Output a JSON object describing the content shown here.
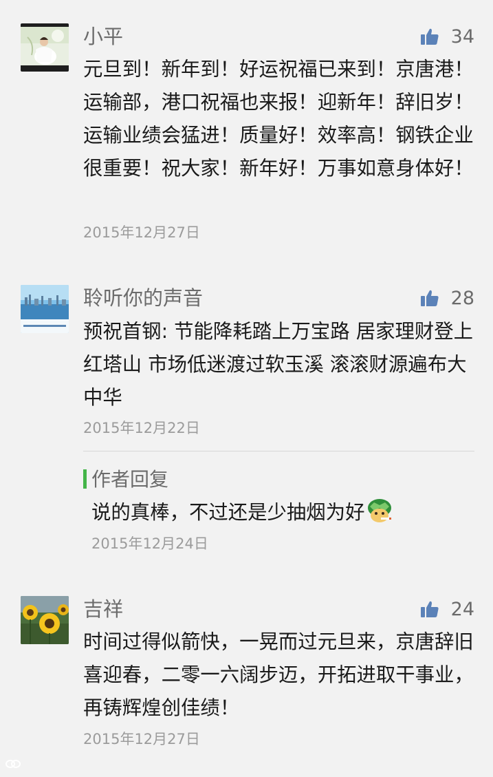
{
  "comments": [
    {
      "username": "小平",
      "likes": "34",
      "content": "元旦到！新年到！好运祝福已来到！京唐港！运输部，港口祝福也来报！迎新年！辞旧岁！运输业绩会猛进！质量好！效率高！钢铁企业很重要！祝大家！新年好！万事如意身体好！",
      "date": "2015年12月27日",
      "avatar": "bride-photo-avatar"
    },
    {
      "username": "聆听你的声音",
      "likes": "28",
      "content": "预祝首钢: 节能降耗踏上万宝路 居家理财登上红塔山 市场低迷渡过软玉溪 滚滚财源遍布大中华",
      "date": "2015年12月22日",
      "avatar": "harbor-skyline-avatar",
      "reply": {
        "title": "作者回复",
        "content": "说的真棒，不过还是少抽烟为好",
        "emoji": "smoking-turtle-emoji",
        "date": "2015年12月24日"
      }
    },
    {
      "username": "吉祥",
      "likes": "24",
      "content": "时间过得似箭快，一晃而过元旦来，京唐辞旧喜迎春，二零一六阔步迈，开拓进取干事业，再铸辉煌创佳绩！",
      "date": "2015年12月27日",
      "avatar": "sunflower-avatar"
    }
  ],
  "icons": {
    "like": "thumbs-up-icon"
  },
  "colors": {
    "like_icon": "#5b82b8",
    "reply_bar": "#44b549",
    "meta_text": "#9b9b9b"
  }
}
